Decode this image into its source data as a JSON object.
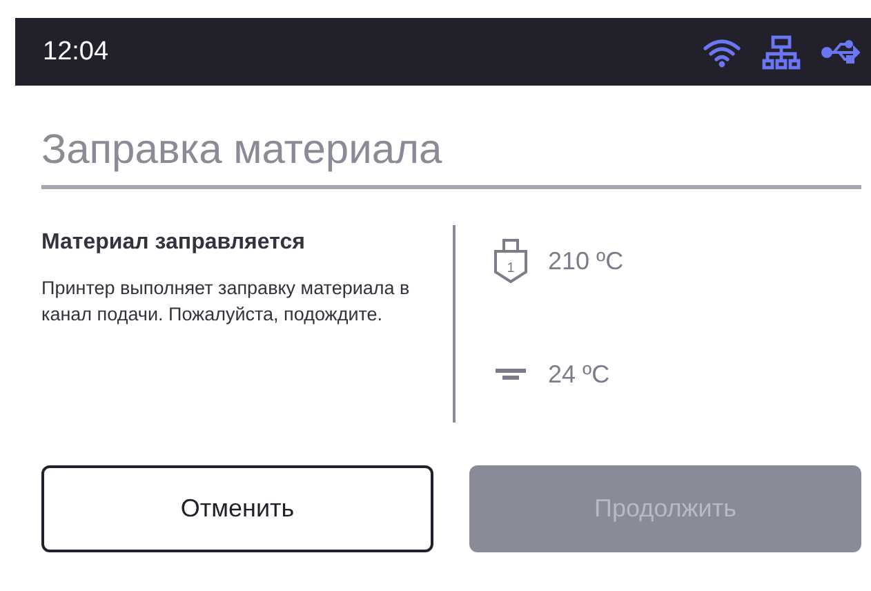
{
  "status_bar": {
    "time": "12:04"
  },
  "title": "Заправка материала",
  "message": {
    "heading": "Материал заправляется",
    "text": "Принтер выполняет заправку материала в канал подачи. Пожалуйста, подождите."
  },
  "temperatures": [
    {
      "kind": "nozzle",
      "number": "1",
      "reading": "210 ºC"
    },
    {
      "kind": "bed",
      "reading": "24 ºC"
    }
  ],
  "buttons": [
    {
      "label": "Отменить",
      "disabled": false
    },
    {
      "label": "Продолжить",
      "disabled": true
    }
  ]
}
